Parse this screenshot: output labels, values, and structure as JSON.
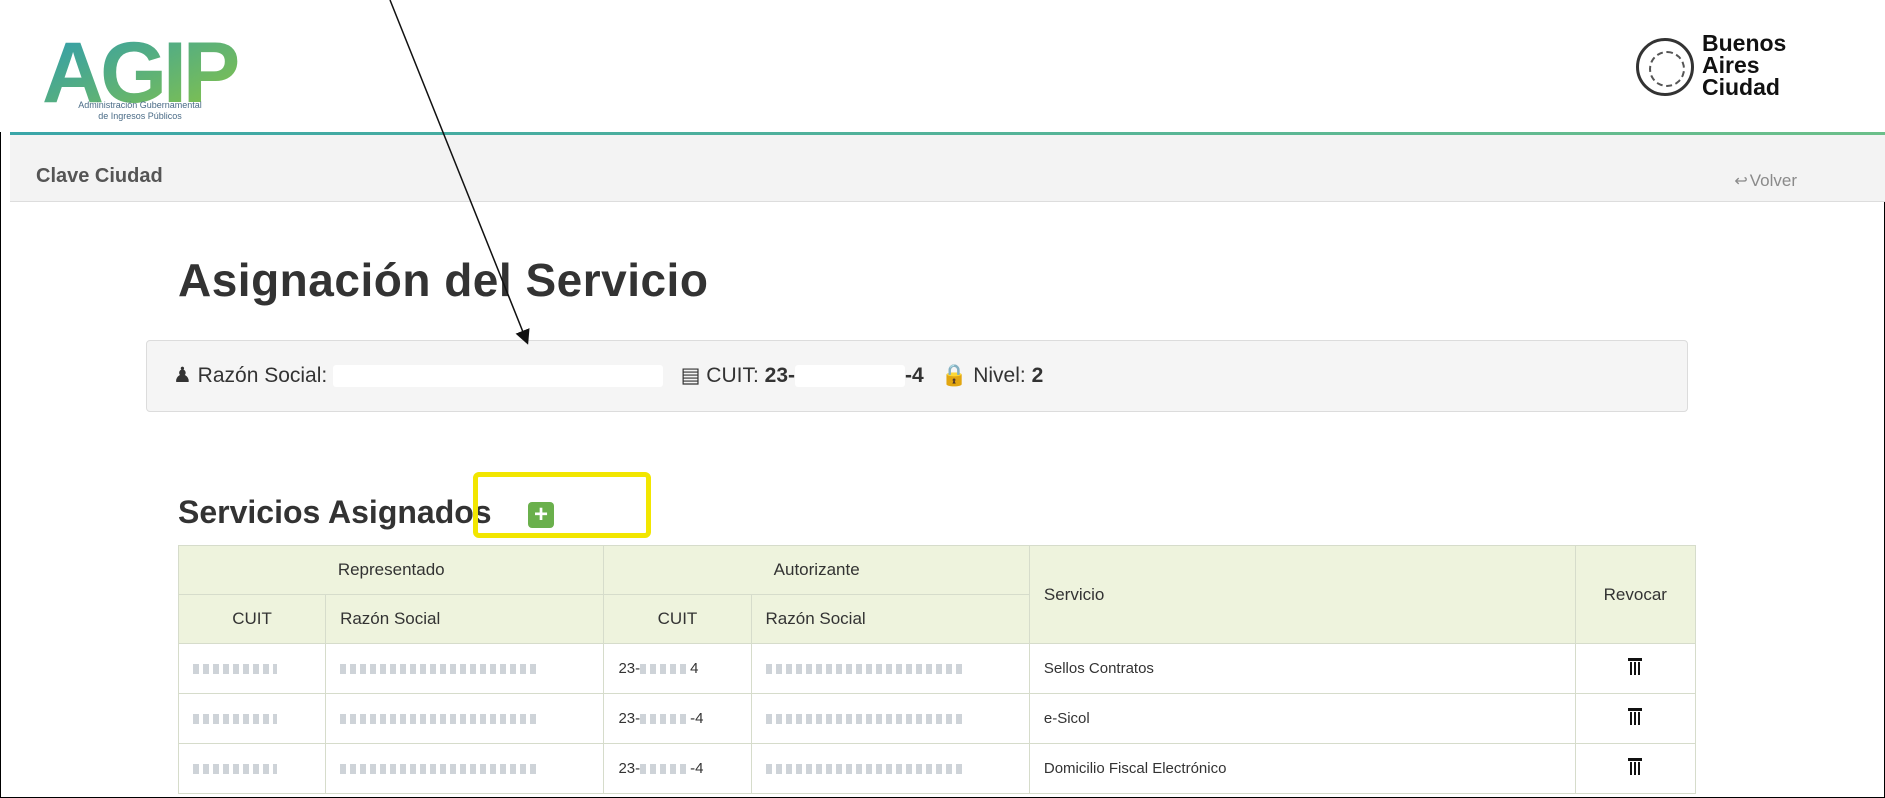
{
  "header": {
    "logo_text": "AGIP",
    "logo_subtitle_1": "Administración Gubernamental",
    "logo_subtitle_2": "de Ingresos Públicos",
    "ba_line1": "Buenos",
    "ba_line2": "Aires",
    "ba_line3": "Ciudad"
  },
  "subbar": {
    "title": "Clave Ciudad",
    "back_label": "Volver"
  },
  "page": {
    "title": "Asignación del Servicio"
  },
  "info": {
    "razon_label": "Razón Social:",
    "cuit_label": "CUIT:",
    "cuit_value": "23-",
    "cuit_suffix": "-4",
    "nivel_label": "Nivel:",
    "nivel_value": "2"
  },
  "section": {
    "title": "Servicios Asignados",
    "add_symbol": "+"
  },
  "table": {
    "group_headers": [
      "Representado",
      "Autorizante"
    ],
    "headers": {
      "cuit": "CUIT",
      "razon_social": "Razón Social",
      "servicio": "Servicio",
      "revocar": "Revocar"
    },
    "rows": [
      {
        "aut_cuit": "23-",
        "aut_cuit_end": "4",
        "servicio": "Sellos Contratos"
      },
      {
        "aut_cuit": "23-",
        "aut_cuit_end": "-4",
        "servicio": "e-Sicol"
      },
      {
        "aut_cuit": "23-",
        "aut_cuit_end": "-4",
        "servicio": "Domicilio Fiscal Electrónico"
      }
    ]
  },
  "colors": {
    "accent_green": "#6ab04c",
    "highlight_yellow": "#f2e600",
    "table_header_bg": "#eef3dd"
  }
}
